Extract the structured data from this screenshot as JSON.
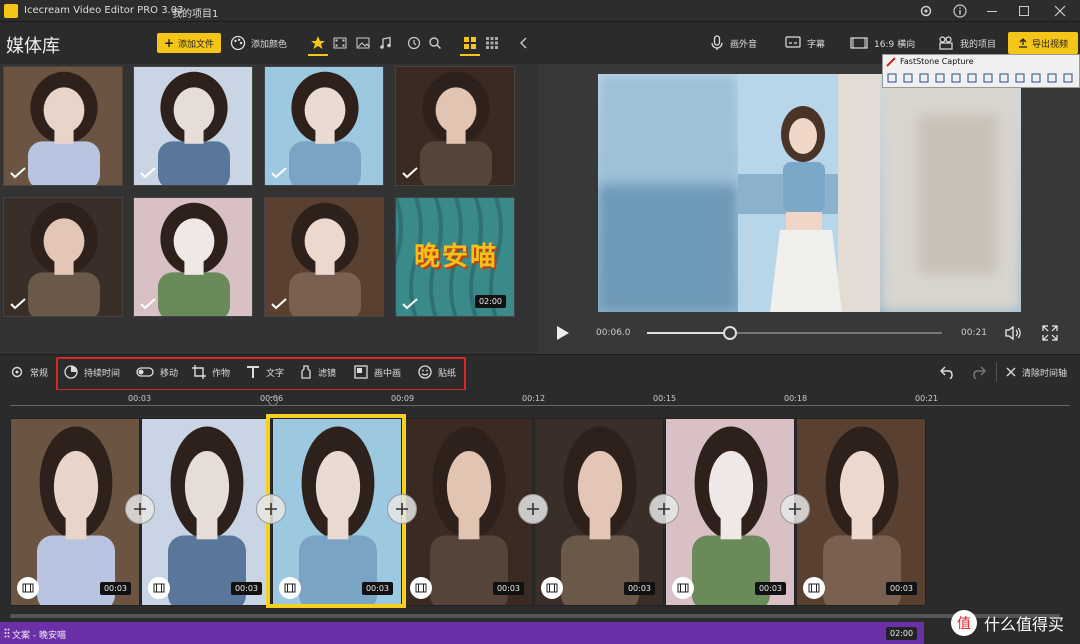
{
  "app": {
    "title": "Icecream Video Editor PRO 3.03",
    "project": "我的项目1"
  },
  "media": {
    "title": "媒体库",
    "add_file": "添加文件",
    "add_color": "添加颜色",
    "items": [
      {
        "palette": [
          "#6b5442",
          "#e8d4c8",
          "#b8c4e0"
        ],
        "checked": true
      },
      {
        "palette": [
          "#c9d4e4",
          "#e6dcd8",
          "#58779a"
        ],
        "checked": true
      },
      {
        "palette": [
          "#9cc8e0",
          "#eadbd2",
          "#7aa4c4"
        ],
        "checked": true
      },
      {
        "palette": [
          "#3a2a22",
          "#e2c4b2",
          "#55443a"
        ],
        "checked": true
      },
      {
        "palette": [
          "#3a2e28",
          "#e4c6b6",
          "#6a5848"
        ],
        "checked": true
      },
      {
        "palette": [
          "#d8c0c4",
          "#f0e8e6",
          "#6a8a5a"
        ],
        "checked": true
      },
      {
        "palette": [
          "#5a4030",
          "#ecd8cc",
          "#7a6050"
        ],
        "checked": true
      },
      {
        "palette": [
          "#3a8a8a",
          "#f0c020",
          "#e07020"
        ],
        "checked": true,
        "duration": "02:00",
        "text": "晚安喵"
      }
    ]
  },
  "preview_toolbar": {
    "voiceover": "画外音",
    "subtitles": "字幕",
    "aspect": "16:9 横向",
    "my_projects": "我的项目",
    "export": "导出视频"
  },
  "faststone": {
    "title": "FastStone Capture"
  },
  "player": {
    "current": "00:06.0",
    "end": "00:21",
    "progress": 0.28
  },
  "edit_toolbar": {
    "general": "常规",
    "duration": "持续时间",
    "move": "移动",
    "crop": "作物",
    "text": "文字",
    "filter": "滤镜",
    "pip": "画中画",
    "sticker": "贴纸",
    "clear_timeline": "清除时间轴"
  },
  "timeline": {
    "ticks": [
      "00:03",
      "00:06",
      "00:09",
      "00:12",
      "00:15",
      "00:18",
      "00:21"
    ],
    "clips": [
      {
        "palette": [
          "#6b5442",
          "#e8d4c8",
          "#b8c4e0"
        ],
        "duration": "00:03"
      },
      {
        "palette": [
          "#c9d4e4",
          "#e6dcd8",
          "#58779a"
        ],
        "duration": "00:03"
      },
      {
        "palette": [
          "#9cc8e0",
          "#eadbd2",
          "#7aa4c4"
        ],
        "duration": "00:03"
      },
      {
        "palette": [
          "#3a2a22",
          "#e2c4b2",
          "#55443a"
        ],
        "duration": "00:03"
      },
      {
        "palette": [
          "#3a2e28",
          "#e4c6b6",
          "#6a5848"
        ],
        "duration": "00:03"
      },
      {
        "palette": [
          "#d8c0c4",
          "#f0e8e6",
          "#6a8a5a"
        ],
        "duration": "00:03"
      },
      {
        "palette": [
          "#5a4030",
          "#ecd8cc",
          "#7a6050"
        ],
        "duration": "00:03"
      }
    ],
    "text_track": {
      "label": "文案 - 晚安喵",
      "duration": "02:00"
    }
  },
  "watermark": {
    "text": "什么值得买"
  },
  "colors": {
    "accent": "#f5c518",
    "highlight": "#d9262c",
    "text_track": "#6b2fa8"
  }
}
